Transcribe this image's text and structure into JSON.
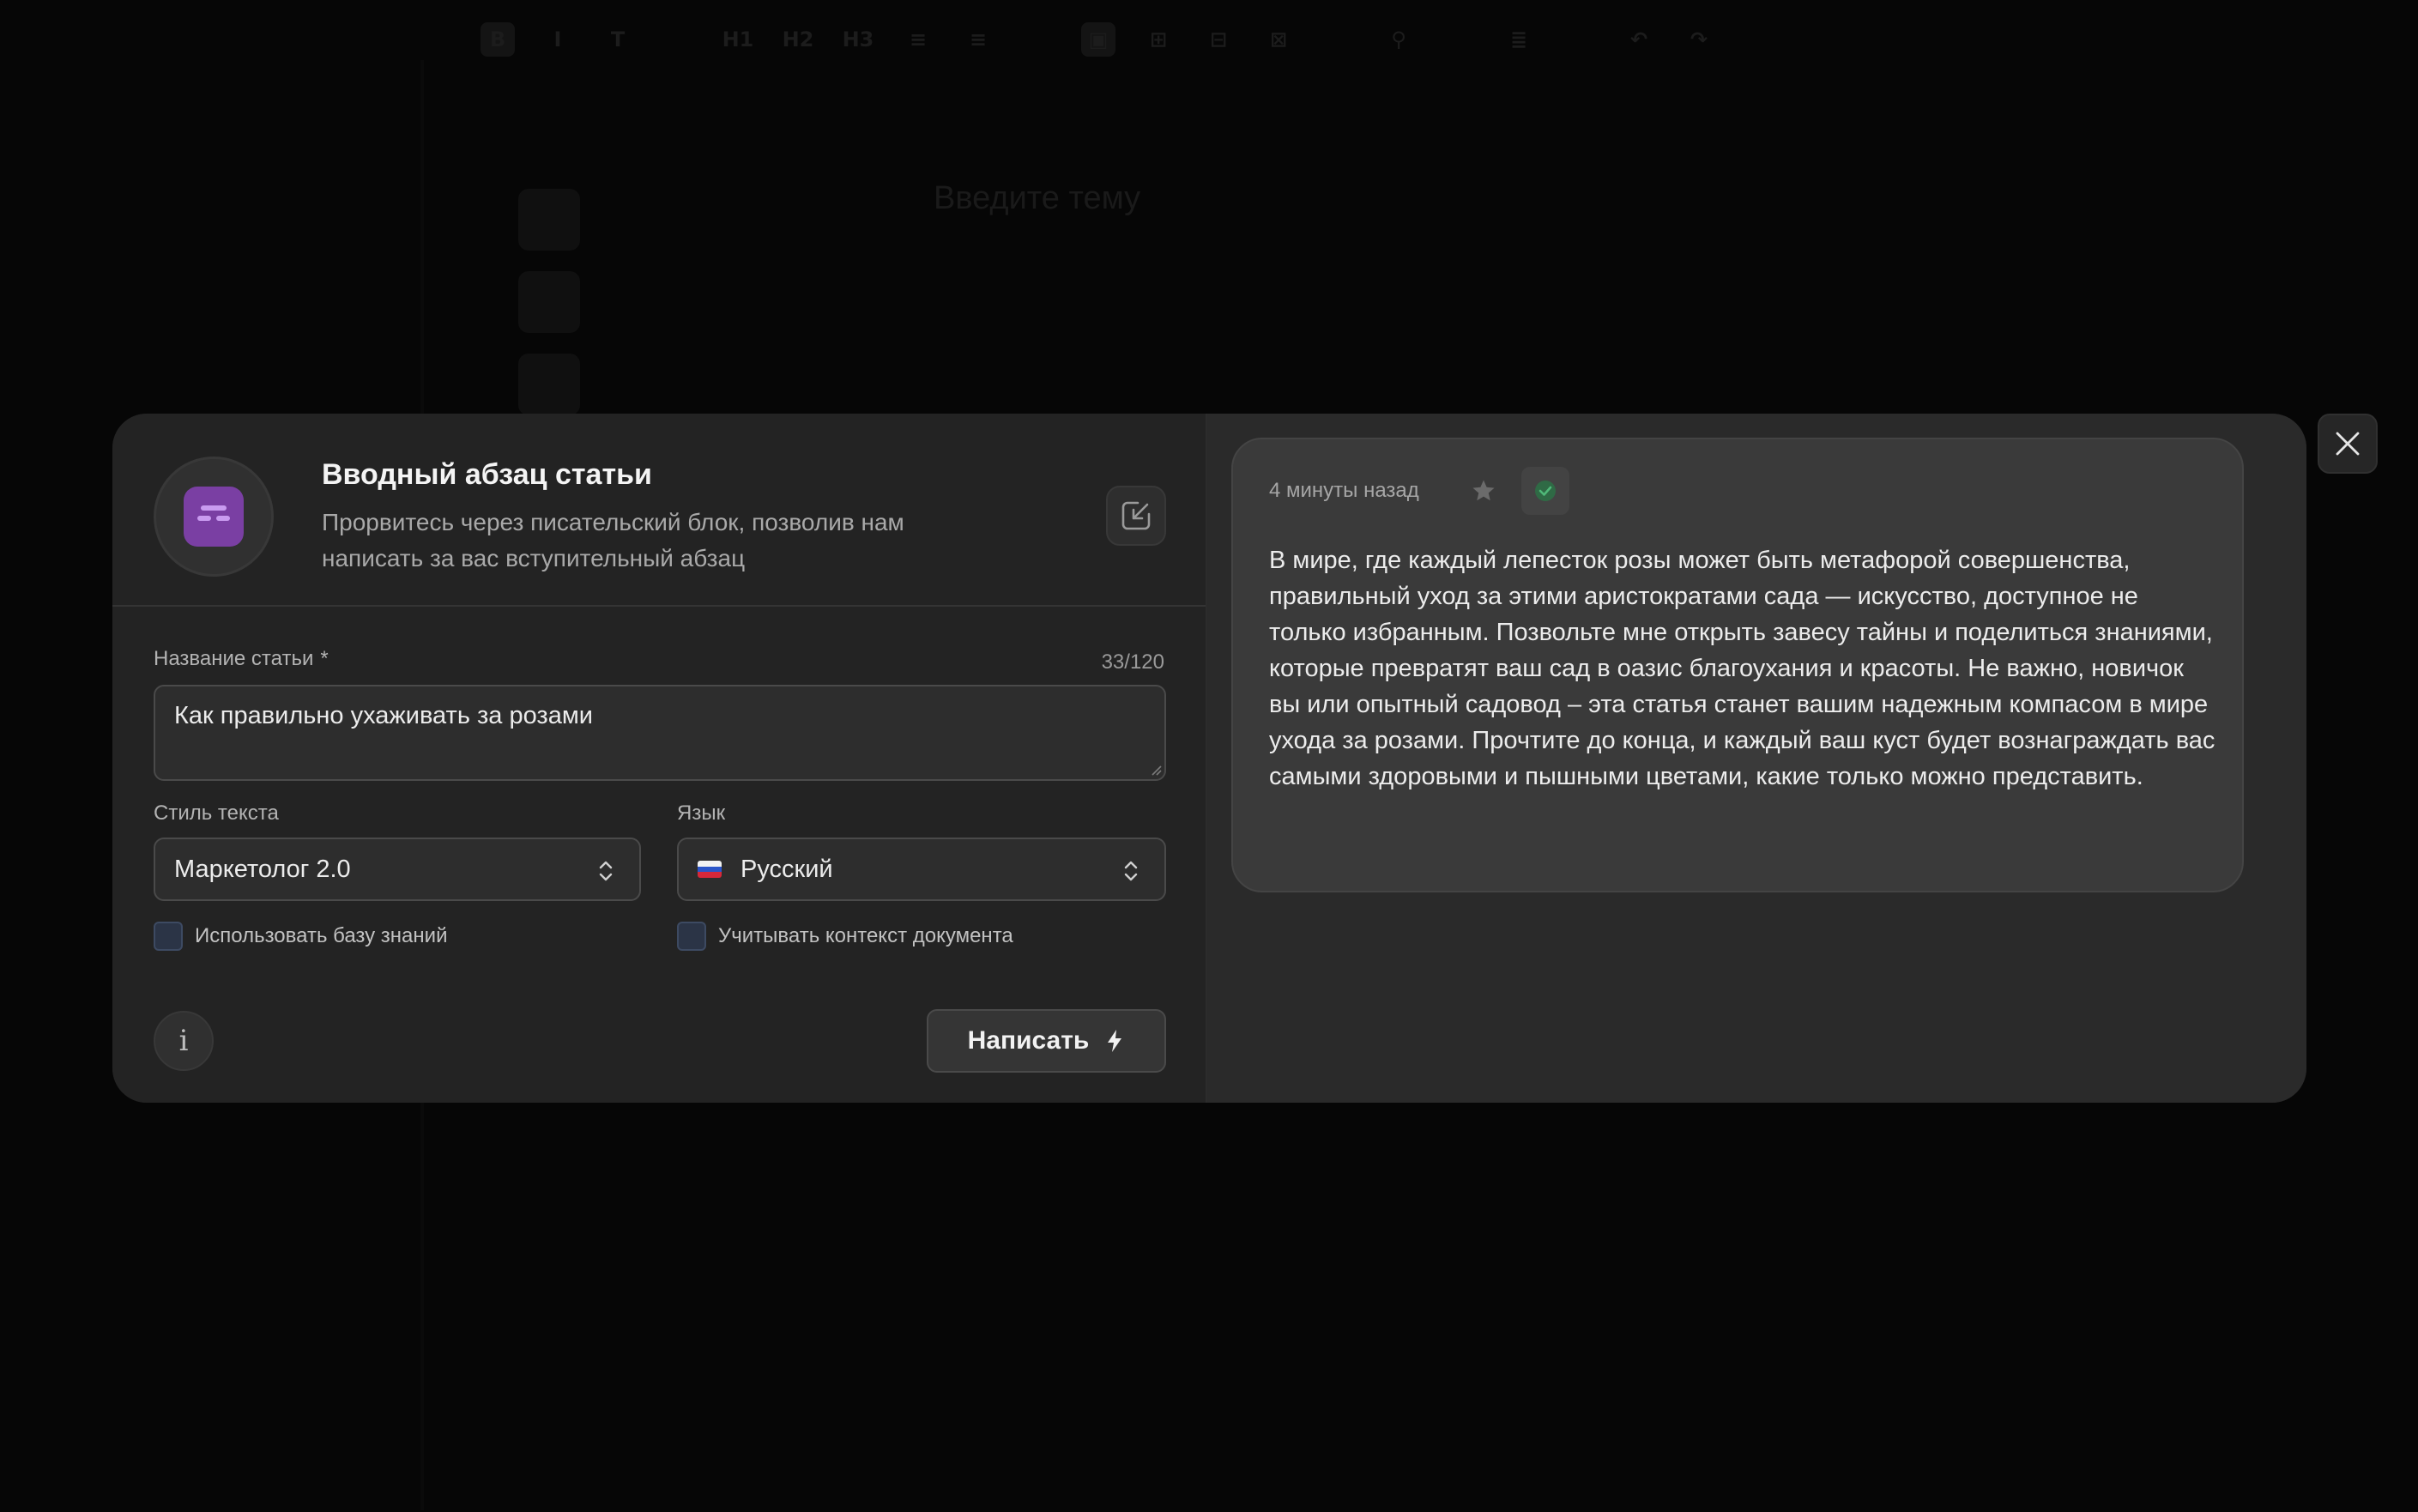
{
  "background": {
    "toolbar_items": [
      "B",
      "I",
      "T",
      "H1",
      "H2",
      "H3",
      "≡",
      "≡",
      "▣",
      "⊞",
      "⊟",
      "⊠",
      "⚲",
      "≣",
      "↶",
      "↷"
    ],
    "title_placeholder": "Введите тему"
  },
  "modal": {
    "title": "Вводный абзац статьи",
    "description": "Прорвитесь через писательский блок, позволив нам написать за вас вступительный абзац",
    "icon": "document-template-icon",
    "accent_color": "#7a3fa3",
    "form": {
      "article_title_label": "Название статьи",
      "required_mark": "*",
      "counter_current": "33",
      "counter_sep": "/",
      "counter_max": "120",
      "article_title_value": "Как правильно ухаживать за розами",
      "style_label": "Стиль текста",
      "style_value": "Маркетолог 2.0",
      "language_label": "Язык",
      "language_value": "Русский",
      "knowledge_base_label": "Использовать базу знаний",
      "doc_context_label": "Учитывать контекст документа",
      "write_button": "Написать"
    },
    "result": {
      "time": "4 минуты назад",
      "text": "В мире, где каждый лепесток розы может быть метафорой совершенства, правильный уход за этими аристократами сада — искусство, доступное не только избранным. Позвольте мне открыть завесу тайны и поделиться знаниями, которые превратят ваш сад в оазис благоухания и красоты. Не важно, новичок вы или опытный садовод – эта статья станет вашим надежным компасом в мире ухода за розами. Прочтите до конца, и каждый ваш куст будет вознаграждать вас самыми здоровыми и пышными цветами, какие только можно представить."
    }
  }
}
